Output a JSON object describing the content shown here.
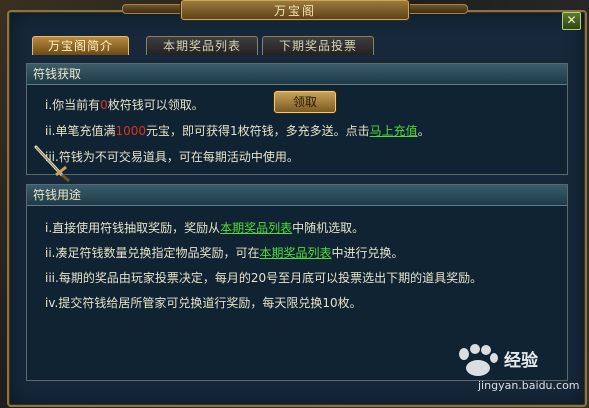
{
  "window": {
    "title": "万宝阁",
    "close_icon": "close-icon"
  },
  "tabs": [
    {
      "label": "万宝阁简介",
      "active": true
    },
    {
      "label": "本期奖品列表",
      "active": false
    },
    {
      "label": "下期奖品投票",
      "active": false
    }
  ],
  "section_obtain": {
    "header": "符钱获取",
    "line1": {
      "prefix": "i.你当前有",
      "count": "0",
      "suffix": "枚符钱可以领取。"
    },
    "claim_button": "领取",
    "line2": {
      "text": "ii.单笔充值满",
      "amount": "1000",
      "rest": "元宝，即可获得1枚符钱，多充多送。点击",
      "link": "马上充值",
      "end": "。"
    },
    "line3": "iii.符钱为不可交易道具，可在每期活动中使用。"
  },
  "section_use": {
    "header": "符钱用途",
    "line1": {
      "text": "i.直接使用符钱抽取奖励，奖励从",
      "link": "本期奖品列表",
      "end": "中随机选取。"
    },
    "line2": {
      "text": "ii.凑足符钱数量兑换指定物品奖励，可在",
      "link": "本期奖品列表",
      "end": "中进行兑换。"
    },
    "line3": "iii.每期的奖品由玩家投票决定，每月的20号至月底可以投票选出下期的道具奖励。",
    "line4": "iv.提交符钱给居所管家可兑换道行奖励，每天限兑换10枚。"
  },
  "watermark": {
    "brand": "经验",
    "url": "jingyan.baidu.com"
  },
  "colors": {
    "accent_gold": "#c9a35a",
    "link_green": "#4fdc3a",
    "count_red": "#e03020",
    "panel_bg": "#0f2333"
  }
}
